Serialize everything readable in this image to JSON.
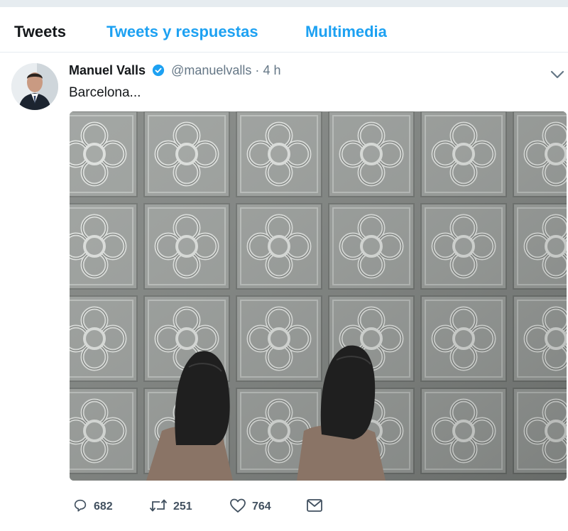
{
  "tabs": [
    {
      "label": "Tweets",
      "active": true
    },
    {
      "label": "Tweets y respuestas",
      "active": false
    },
    {
      "label": "Multimedia",
      "active": false
    }
  ],
  "tweet": {
    "author_name": "Manuel Valls",
    "verified": true,
    "handle": "@manuelvalls",
    "separator": "·",
    "time": "4 h",
    "text": "Barcelona...",
    "replies": "682",
    "retweets": "251",
    "likes": "764"
  },
  "colors": {
    "accent": "#1da1f2",
    "text": "#14171a",
    "muted": "#657786",
    "tile": "#9a9e9c"
  },
  "icons": [
    "verified-badge-icon",
    "chevron-down-icon",
    "reply-icon",
    "retweet-icon",
    "like-icon",
    "message-icon"
  ]
}
